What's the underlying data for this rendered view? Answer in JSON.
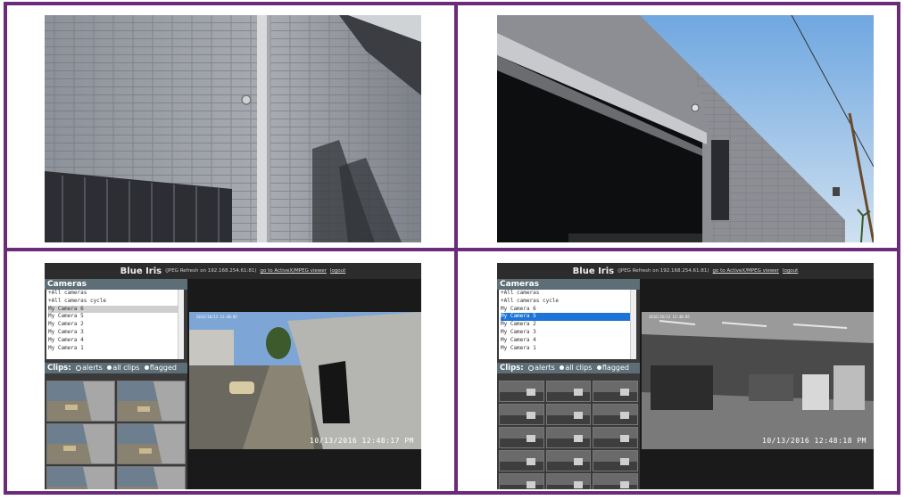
{
  "blue_iris": {
    "title": "Blue Iris",
    "subtitle": "(JPEG Refresh on 192.168.254.61:81)",
    "activex_link": "go to ActiveX/MPEG viewer",
    "logout_link": "logout",
    "cameras_heading": "Cameras",
    "camera_items": [
      "+All cameras",
      "+All cameras cycle",
      "My Camera 6",
      "My Camera 5",
      "My Camera 2",
      "My Camera 3",
      "My Camera 4",
      "My Camera 1"
    ],
    "clips_heading": "Clips:",
    "clips_options": [
      "alerts",
      "all clips",
      "flagged"
    ]
  },
  "left_view": {
    "selected_camera": "My Camera 6",
    "osd_top": "2016/10/13 12:48:05",
    "timestamp": "10/13/2016 12:48:17 PM"
  },
  "right_view": {
    "selected_camera": "My Camera 5",
    "osd_top": "2016/10/13 12:48:05",
    "timestamp": "10/13/2016 12:48:18 PM"
  },
  "colors": {
    "frame": "#6b2a7a",
    "section_header": "#5d6e76",
    "selected_blue": "#1e73d6",
    "selected_grey": "#cfcfcf"
  }
}
